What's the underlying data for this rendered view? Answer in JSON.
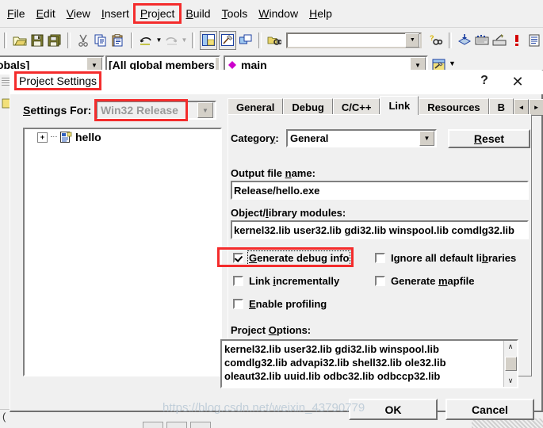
{
  "menubar": {
    "items": [
      {
        "label": "File",
        "accel": "F",
        "highlighted": false
      },
      {
        "label": "Edit",
        "accel": "E",
        "highlighted": false
      },
      {
        "label": "View",
        "accel": "V",
        "highlighted": false
      },
      {
        "label": "Insert",
        "accel": "I",
        "highlighted": false
      },
      {
        "label": "Project",
        "accel": "P",
        "highlighted": true
      },
      {
        "label": "Build",
        "accel": "B",
        "highlighted": false
      },
      {
        "label": "Tools",
        "accel": "T",
        "highlighted": false
      },
      {
        "label": "Window",
        "accel": "W",
        "highlighted": false
      },
      {
        "label": "Help",
        "accel": "H",
        "highlighted": false
      }
    ]
  },
  "toolbar": {
    "icons": [
      "open-folder-icon",
      "save-icon",
      "save-all-icon",
      "cut-icon",
      "copy-icon",
      "paste-icon",
      "undo-icon",
      "redo-icon",
      "workspace-icon",
      "output-window-icon",
      "window-list-icon",
      "find-in-files-icon"
    ],
    "find_box_value": "",
    "find_box_placeholder": "",
    "help_search_icon": "find-help-icon",
    "build_icons": [
      "compile-icon",
      "build-icon",
      "execute-icon",
      "breakpoint-icon",
      "list-icon"
    ]
  },
  "wizardbar": {
    "scope_combo": "obals]",
    "members_combo": "[All global members",
    "symbol_combo": "main",
    "symbol_icon": "member-diamond-icon",
    "action_icon": "wizardbar-action-icon"
  },
  "dialog": {
    "title": "Project Settings",
    "title_highlighted": true,
    "help_button": "?",
    "close_button": "✕",
    "settings_for": {
      "label": "Settings For:",
      "accel": "S",
      "value": "Win32 Release",
      "disabled": true,
      "highlighted": true
    },
    "tree": {
      "items": [
        {
          "label": "hello",
          "expander": "+",
          "icon": "project-node-icon"
        }
      ]
    },
    "tabs": [
      {
        "label": "General",
        "active": false
      },
      {
        "label": "Debug",
        "active": false
      },
      {
        "label": "C/C++",
        "active": false
      },
      {
        "label": "Link",
        "active": true
      },
      {
        "label": "Resources",
        "active": false
      },
      {
        "label": "B",
        "active": false
      }
    ],
    "tab_scroll_left": "◄",
    "tab_scroll_right": "►",
    "category": {
      "label": "Category:",
      "accel": "y",
      "value": "General"
    },
    "reset_button": {
      "label": "Reset",
      "accel": "R"
    },
    "output_file": {
      "label": "Output file name:",
      "accel": "n",
      "value": "Release/hello.exe"
    },
    "object_modules": {
      "label": "Object/library modules:",
      "accel": "l",
      "value": "kernel32.lib user32.lib gdi32.lib winspool.lib comdlg32.lib"
    },
    "checkboxes": [
      {
        "label": "Generate debug info",
        "accel": "G",
        "checked": true,
        "focused": true,
        "highlighted": true,
        "col": 0,
        "row": 0
      },
      {
        "label": "Ignore all default libraries",
        "accel": "b",
        "checked": false,
        "focused": false,
        "highlighted": false,
        "col": 1,
        "row": 0
      },
      {
        "label": "Link incrementally",
        "accel": "i",
        "checked": false,
        "focused": false,
        "highlighted": false,
        "col": 0,
        "row": 1
      },
      {
        "label": "Generate mapfile",
        "accel": "m",
        "checked": false,
        "focused": false,
        "highlighted": false,
        "col": 1,
        "row": 1
      },
      {
        "label": "Enable profiling",
        "accel": "E",
        "checked": false,
        "focused": false,
        "highlighted": false,
        "col": 0,
        "row": 2
      }
    ],
    "project_options": {
      "label": "Project Options:",
      "accel": "O",
      "value": "kernel32.lib user32.lib gdi32.lib winspool.lib\ncomdlg32.lib advapi32.lib shell32.lib ole32.lib\noleaut32.lib uuid.lib odbc32.lib odbccp32.lib",
      "scrollbar": {
        "up": "∧",
        "down": "∨"
      }
    },
    "ok_button": "OK",
    "cancel_button": "Cancel"
  },
  "watermark": "https://blog.csdn.net/weixin_43790779",
  "colors": {
    "highlight_red": "#f42c2c",
    "dialog_face": "#f0f0f0",
    "field_white": "#ffffff",
    "disabled_text": "#9a9a9a",
    "watermark": "#b9c9d6"
  }
}
